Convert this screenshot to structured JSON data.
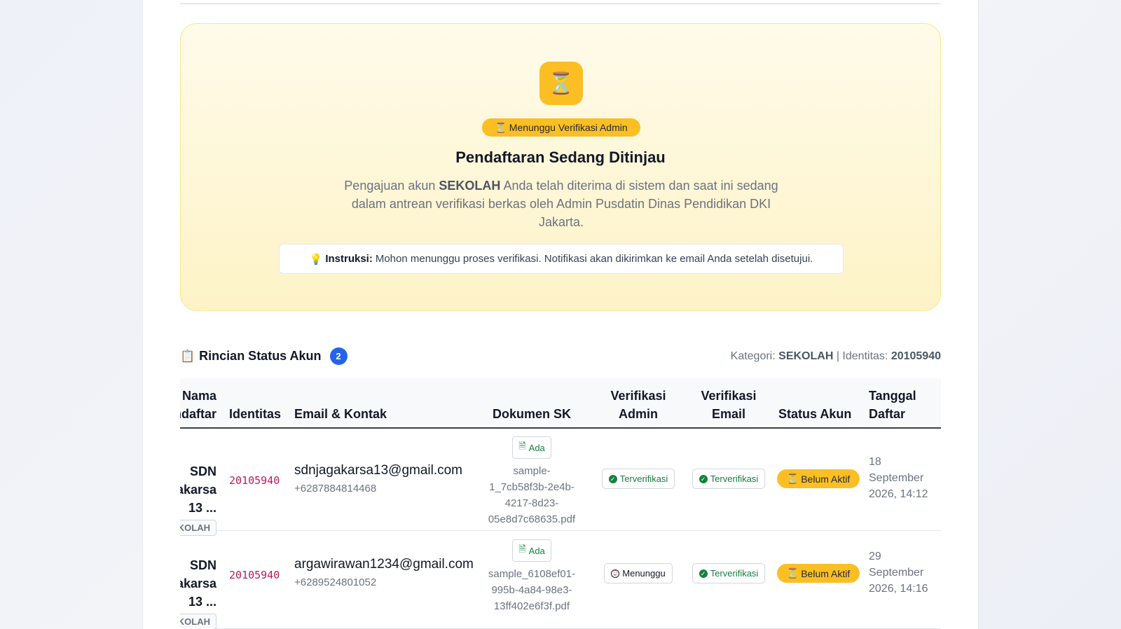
{
  "hero": {
    "icon": "hourglass-icon",
    "badge_icon": "⏳",
    "badge_label": "Menunggu Verifikasi Admin",
    "title": "Pendaftaran Sedang Ditinjau",
    "desc_prefix": "Pengajuan akun ",
    "desc_category": "SEKOLAH",
    "desc_suffix": " Anda telah diterima di sistem dan saat ini sedang dalam antrean verifikasi berkas oleh Admin Pusdatin Dinas Pendidikan DKI Jakarta.",
    "instruction_label": "Instruksi:",
    "instruction_text": "Mohon menunggu proses verifikasi. Notifikasi akan dikirimkan ke email Anda setelah disetujui."
  },
  "section": {
    "title": "Rincian Status Akun",
    "count": "2",
    "meta_category_label": "Kategori:",
    "meta_category_value": "SEKOLAH",
    "meta_sep": "| Identitas:",
    "meta_identity_value": "20105940"
  },
  "table": {
    "headers": {
      "name_line1": "Nama",
      "name_line2": "Pendaftar",
      "identity": "Identitas",
      "email": "Email & Kontak",
      "doc": "Dokumen SK",
      "admin_line1": "Verifikasi",
      "admin_line2": "Admin",
      "email_ver_line1": "Verifikasi",
      "email_ver_line2": "Email",
      "account": "Status Akun",
      "date_line1": "Tanggal",
      "date_line2": "Daftar"
    },
    "rows": [
      {
        "name_line1": "SDN Jagakarsa",
        "name_line2": "13 ...",
        "category": "SEKOLAH",
        "identity": "20105940",
        "email": "sdnjagakarsa13@gmail.com",
        "phone": "+6287884814468",
        "doc_label": "Ada",
        "doc_name_1": "sample-",
        "doc_name_2": "1_7cb58f3b-2e4b-",
        "doc_name_3": "4217-8d23-",
        "doc_name_4": "05e8d7c68635.pdf",
        "admin_status": "Terverifikasi",
        "email_status": "Terverifikasi",
        "account_status": "Belum Aktif",
        "date_1": "18",
        "date_2": "September",
        "date_3": "2026, 14:12"
      },
      {
        "name_line1": "SDN Jagakarsa",
        "name_line2": "13 ...",
        "category": "SEKOLAH",
        "identity": "20105940",
        "email": "argawirawan1234@gmail.com",
        "phone": "+6289524801052",
        "doc_label": "Ada",
        "doc_name_1": "sample_6108ef01-",
        "doc_name_2": "995b-4a84-98e3-",
        "doc_name_3": "13ff402e6f3f.pdf",
        "admin_status": "Menunggu",
        "email_status": "Terverifikasi",
        "account_status": "Belum Aktif",
        "date_1": "29",
        "date_2": "September",
        "date_3": "2026, 14:16"
      }
    ]
  },
  "colors": {
    "accent_yellow": "#fbbf24",
    "success_green": "#15803d",
    "identity_pink": "#be185d",
    "badge_blue": "#2563eb"
  }
}
